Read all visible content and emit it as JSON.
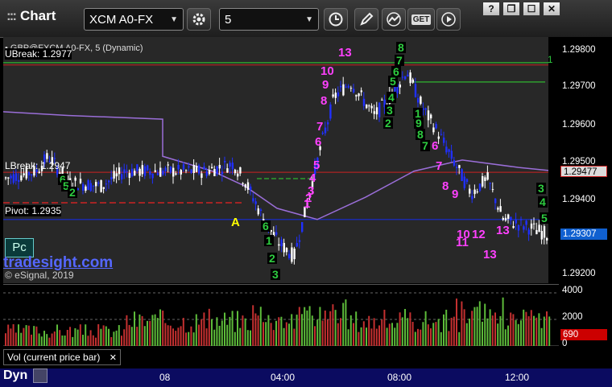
{
  "toolbar": {
    "title": "Chart",
    "symbol": "XCM A0-FX",
    "interval": "5",
    "grip": ":::",
    "window_buttons": [
      "?",
      "❐",
      "☐",
      "✕"
    ]
  },
  "chart": {
    "title_line": "• GBP@FXCM A0-FX, 5 (Dynamic)",
    "labels": {
      "ubreak": "UBreak: 1.2977",
      "lbreak": "LBreak: 1.2947",
      "pivot": "Pivot: 1.2935",
      "pc_button": "Pc",
      "brand": "tradesight.com",
      "copyright": "© eSignal, 2019",
      "marker_a": "A"
    },
    "price_axis": {
      "ticks": [
        "1.29800",
        "1.29700",
        "1.29600",
        "1.29500",
        "1.29400",
        "1.29300",
        "1.29200"
      ],
      "current_price_tag": "1.29307",
      "break_tag": "1.29477",
      "pivot_hint": "1"
    },
    "volume": {
      "label": "Vol (current price bar)",
      "close_glyph": "✕",
      "ticks": [
        "4000",
        "2000",
        "0"
      ],
      "current_value": "690"
    },
    "time_axis": {
      "labels": [
        "08",
        "04:00",
        "08:00",
        "12:00"
      ],
      "dyn_label": "Dyn"
    }
  },
  "colors": {
    "up_candle": "#ffffff",
    "down_candle": "#2030ff",
    "ubreak_line": "#2e9e2e",
    "lbreak_line": "#c22",
    "pivot_line": "#1a2aaa",
    "avg_line": "#9a6ed8",
    "td_count_sell": "#ff40ff",
    "td_count_buy": "#2ecc40",
    "vol_up": "#5dbb3a",
    "vol_down": "#c43030",
    "current_tag": "#1060d0",
    "vol_tag": "#cc0000"
  },
  "td_sequential": {
    "magenta": [
      "13",
      "10",
      "9",
      "8",
      "7",
      "6",
      "5",
      "4",
      "3",
      "2",
      "1",
      "5",
      "6",
      "7",
      "8",
      "9",
      "10",
      "11",
      "12",
      "13"
    ],
    "green": [
      "8",
      "7",
      "6",
      "5",
      "4",
      "3",
      "2",
      "1",
      "9",
      "8",
      "7",
      "6",
      "5",
      "2",
      "3",
      "4",
      "5",
      "6",
      "1",
      "2",
      "3"
    ]
  }
}
